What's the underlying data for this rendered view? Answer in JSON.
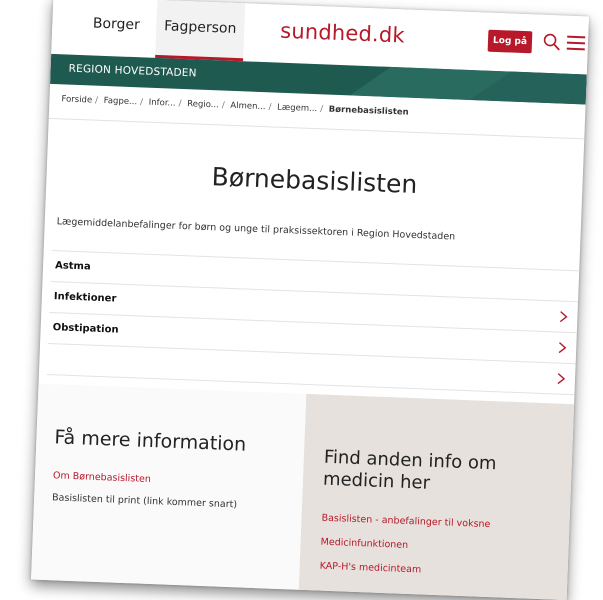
{
  "nav": {
    "tab_borger": "Borger",
    "tab_fagperson": "Fagperson",
    "logo_text": "sundhed.dk",
    "login_label": "Log på"
  },
  "region": {
    "label": "REGION HOVEDSTADEN"
  },
  "breadcrumb": {
    "items": [
      "Forside",
      "Fagpe...",
      "Infor...",
      "Regio...",
      "Almen...",
      "Lægem..."
    ],
    "current": "Børnebasislisten"
  },
  "page": {
    "title": "Børnebasislisten",
    "subtitle": "Lægemiddelanbefalinger for børn og unge til praksissektoren i Region Hovedstaden"
  },
  "list": {
    "items": [
      {
        "label": "Astma"
      },
      {
        "label": "Infektioner"
      },
      {
        "label": "Obstipation"
      },
      {
        "label": ""
      }
    ]
  },
  "more_info": {
    "title": "Få mere information",
    "link1": "Om Børnebasislisten",
    "text2": "Basislisten til print (link kommer snart)"
  },
  "other_info": {
    "title": "Find anden info om medicin her",
    "links": [
      "Basislisten - anbefalinger til voksne",
      "Medicinfunktionen",
      "KAP-H's medicinteam"
    ]
  },
  "colors": {
    "brand_red": "#b7182a",
    "region_green": "#1f5a50",
    "panel_beige": "#e6e1dc"
  },
  "icons": {
    "search": "search-icon",
    "menu": "hamburger-menu-icon",
    "chevron": "chevron-right-icon"
  }
}
